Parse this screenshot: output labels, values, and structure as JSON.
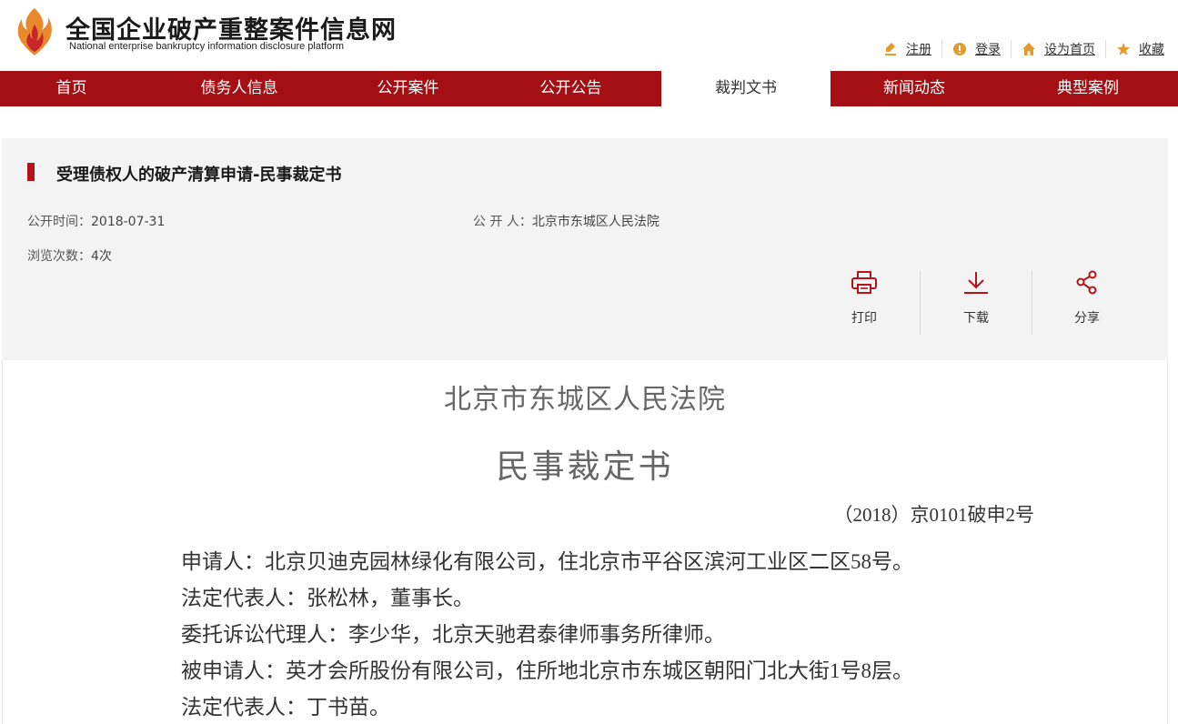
{
  "header": {
    "site_title": "全国企业破产重整案件信息网",
    "site_subtitle": "National enterprise bankruptcy  information disclosure platform",
    "links": [
      {
        "label": "注册",
        "icon": "register-icon"
      },
      {
        "label": "登录",
        "icon": "login-icon"
      },
      {
        "label": "设为首页",
        "icon": "home-icon"
      },
      {
        "label": "收藏",
        "icon": "star-icon"
      }
    ]
  },
  "nav": {
    "items": [
      "首页",
      "债务人信息",
      "公开案件",
      "公开公告",
      "裁判文书",
      "新闻动态",
      "典型案例"
    ],
    "active_index": 4
  },
  "info": {
    "title": "受理债权人的破产清算申请-民事裁定书",
    "publish_time_label": "公开时间：",
    "publish_time": "2018-07-31",
    "publisher_label": "公 开 人：",
    "publisher": "北京市东城区人民法院",
    "views_label": "浏览次数：",
    "views": "4次",
    "actions": [
      {
        "label": "打印",
        "icon": "print-icon"
      },
      {
        "label": "下载",
        "icon": "download-icon"
      },
      {
        "label": "分享",
        "icon": "share-icon"
      }
    ]
  },
  "document": {
    "court": "北京市东城区人民法院",
    "doc_type": "民事裁定书",
    "case_no": "（2018）京0101破申2号",
    "paragraphs": [
      "申请人：北京贝迪克园林绿化有限公司，住北京市平谷区滨河工业区二区58号。",
      "法定代表人：张松林，董事长。",
      "委托诉讼代理人：李少华，北京天驰君泰律师事务所律师。",
      "被申请人：英才会所股份有限公司，住所地北京市东城区朝阳门北大街1号8层。",
      "法定代表人：丁书苗。"
    ]
  },
  "colors": {
    "brand_red": "#a30f13",
    "accent_red": "#b3131a",
    "icon_orange": "#e39a2e"
  }
}
